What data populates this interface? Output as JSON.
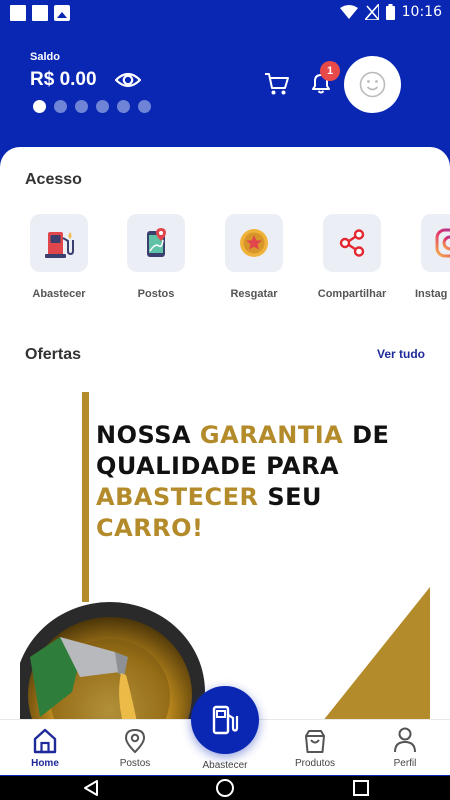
{
  "status": {
    "time": "10:16"
  },
  "header": {
    "saldo_label": "Saldo",
    "saldo_value": "R$ 0.00",
    "carousel_dots": 6,
    "active_dot": 0,
    "notification_count": "1"
  },
  "acesso": {
    "title": "Acesso",
    "items": [
      {
        "label": "Abastecer",
        "icon": "fuel-pump-icon"
      },
      {
        "label": "Postos",
        "icon": "map-pin-phone-icon"
      },
      {
        "label": "Resgatar",
        "icon": "coin-star-icon"
      },
      {
        "label": "Compartilhar",
        "icon": "share-icon"
      },
      {
        "label": "Instag",
        "icon": "instagram-icon"
      }
    ]
  },
  "ofertas": {
    "title": "Ofertas",
    "see_all": "Ver tudo",
    "banner": {
      "line1_a": "NOSSA ",
      "line1_b": "GARANTIA",
      "line1_c": " DE",
      "line2": "QUALIDADE PARA",
      "line3_a": "ABASTECER",
      "line3_b": " SEU ",
      "line3_c": "CARRO!"
    }
  },
  "bottom_nav": {
    "items": [
      {
        "label": "Home",
        "active": true
      },
      {
        "label": "Postos",
        "active": false
      },
      {
        "label": "Produtos",
        "active": false
      },
      {
        "label": "Perfil",
        "active": false
      }
    ],
    "fab_label": "Abastecer"
  },
  "colors": {
    "primary": "#0a27b3",
    "gold": "#b48b2b",
    "badge": "#e84a4a"
  }
}
